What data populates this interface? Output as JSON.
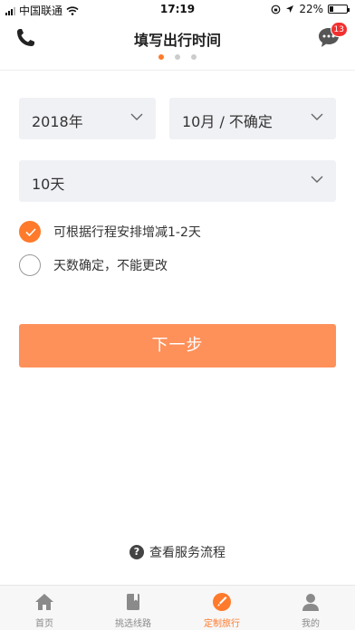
{
  "status_bar": {
    "carrier": "中国联通",
    "time": "17:19",
    "battery": "22%",
    "battery_level": 0.22
  },
  "header": {
    "title": "填写出行时间",
    "message_badge": "13",
    "step_dots": {
      "count": 3,
      "active": 0
    }
  },
  "form": {
    "year": "2018年",
    "month": "10月 / 不确定",
    "days": "10天",
    "options": [
      {
        "label": "可根据行程安排增减1-2天",
        "checked": true
      },
      {
        "label": "天数确定，不能更改",
        "checked": false
      }
    ],
    "next_label": "下一步"
  },
  "process_link": {
    "icon_text": "?",
    "label": "查看服务流程"
  },
  "tabbar": {
    "items": [
      {
        "label": "首页",
        "icon": "home-icon",
        "active": false
      },
      {
        "label": "挑选线路",
        "icon": "book-icon",
        "active": false
      },
      {
        "label": "定制旅行",
        "icon": "custom-trip-icon",
        "active": true
      },
      {
        "label": "我的",
        "icon": "user-icon",
        "active": false
      }
    ]
  },
  "colors": {
    "accent": "#ff7a2a",
    "button": "#fe905a",
    "badge": "#f23030",
    "select_bg": "#f0f1f5"
  }
}
